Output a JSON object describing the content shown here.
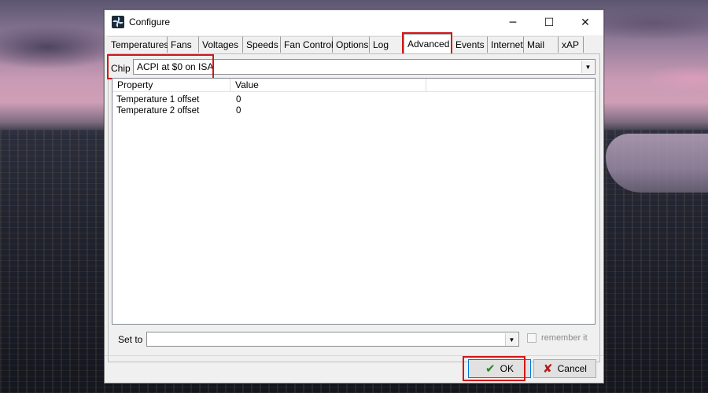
{
  "window": {
    "title": "Configure",
    "icon": "fan-icon"
  },
  "title_buttons": {
    "minimize": "─",
    "maximize": "☐",
    "close": "✕"
  },
  "tabs": [
    {
      "label": "Temperatures"
    },
    {
      "label": "Fans"
    },
    {
      "label": "Voltages"
    },
    {
      "label": "Speeds"
    },
    {
      "label": "Fan Control"
    },
    {
      "label": "Options"
    },
    {
      "label": "Log"
    },
    {
      "label": "Advanced",
      "active": true
    },
    {
      "label": "Events"
    },
    {
      "label": "Internet"
    },
    {
      "label": "Mail"
    },
    {
      "label": "xAP"
    }
  ],
  "chip": {
    "label": "Chip",
    "value": "ACPI at $0 on ISA"
  },
  "table": {
    "columns": [
      "Property",
      "Value"
    ],
    "rows": [
      {
        "property": "Temperature 1 offset",
        "value": "0"
      },
      {
        "property": "Temperature 2 offset",
        "value": "0"
      }
    ]
  },
  "set_to": {
    "label": "Set to",
    "value": ""
  },
  "remember": {
    "label": "remember it",
    "checked": false
  },
  "buttons": {
    "ok": "OK",
    "cancel": "Cancel"
  },
  "colors": {
    "highlight": "#d01818",
    "ok_icon": "#1c8c1c",
    "cancel_icon": "#b51a1a"
  }
}
